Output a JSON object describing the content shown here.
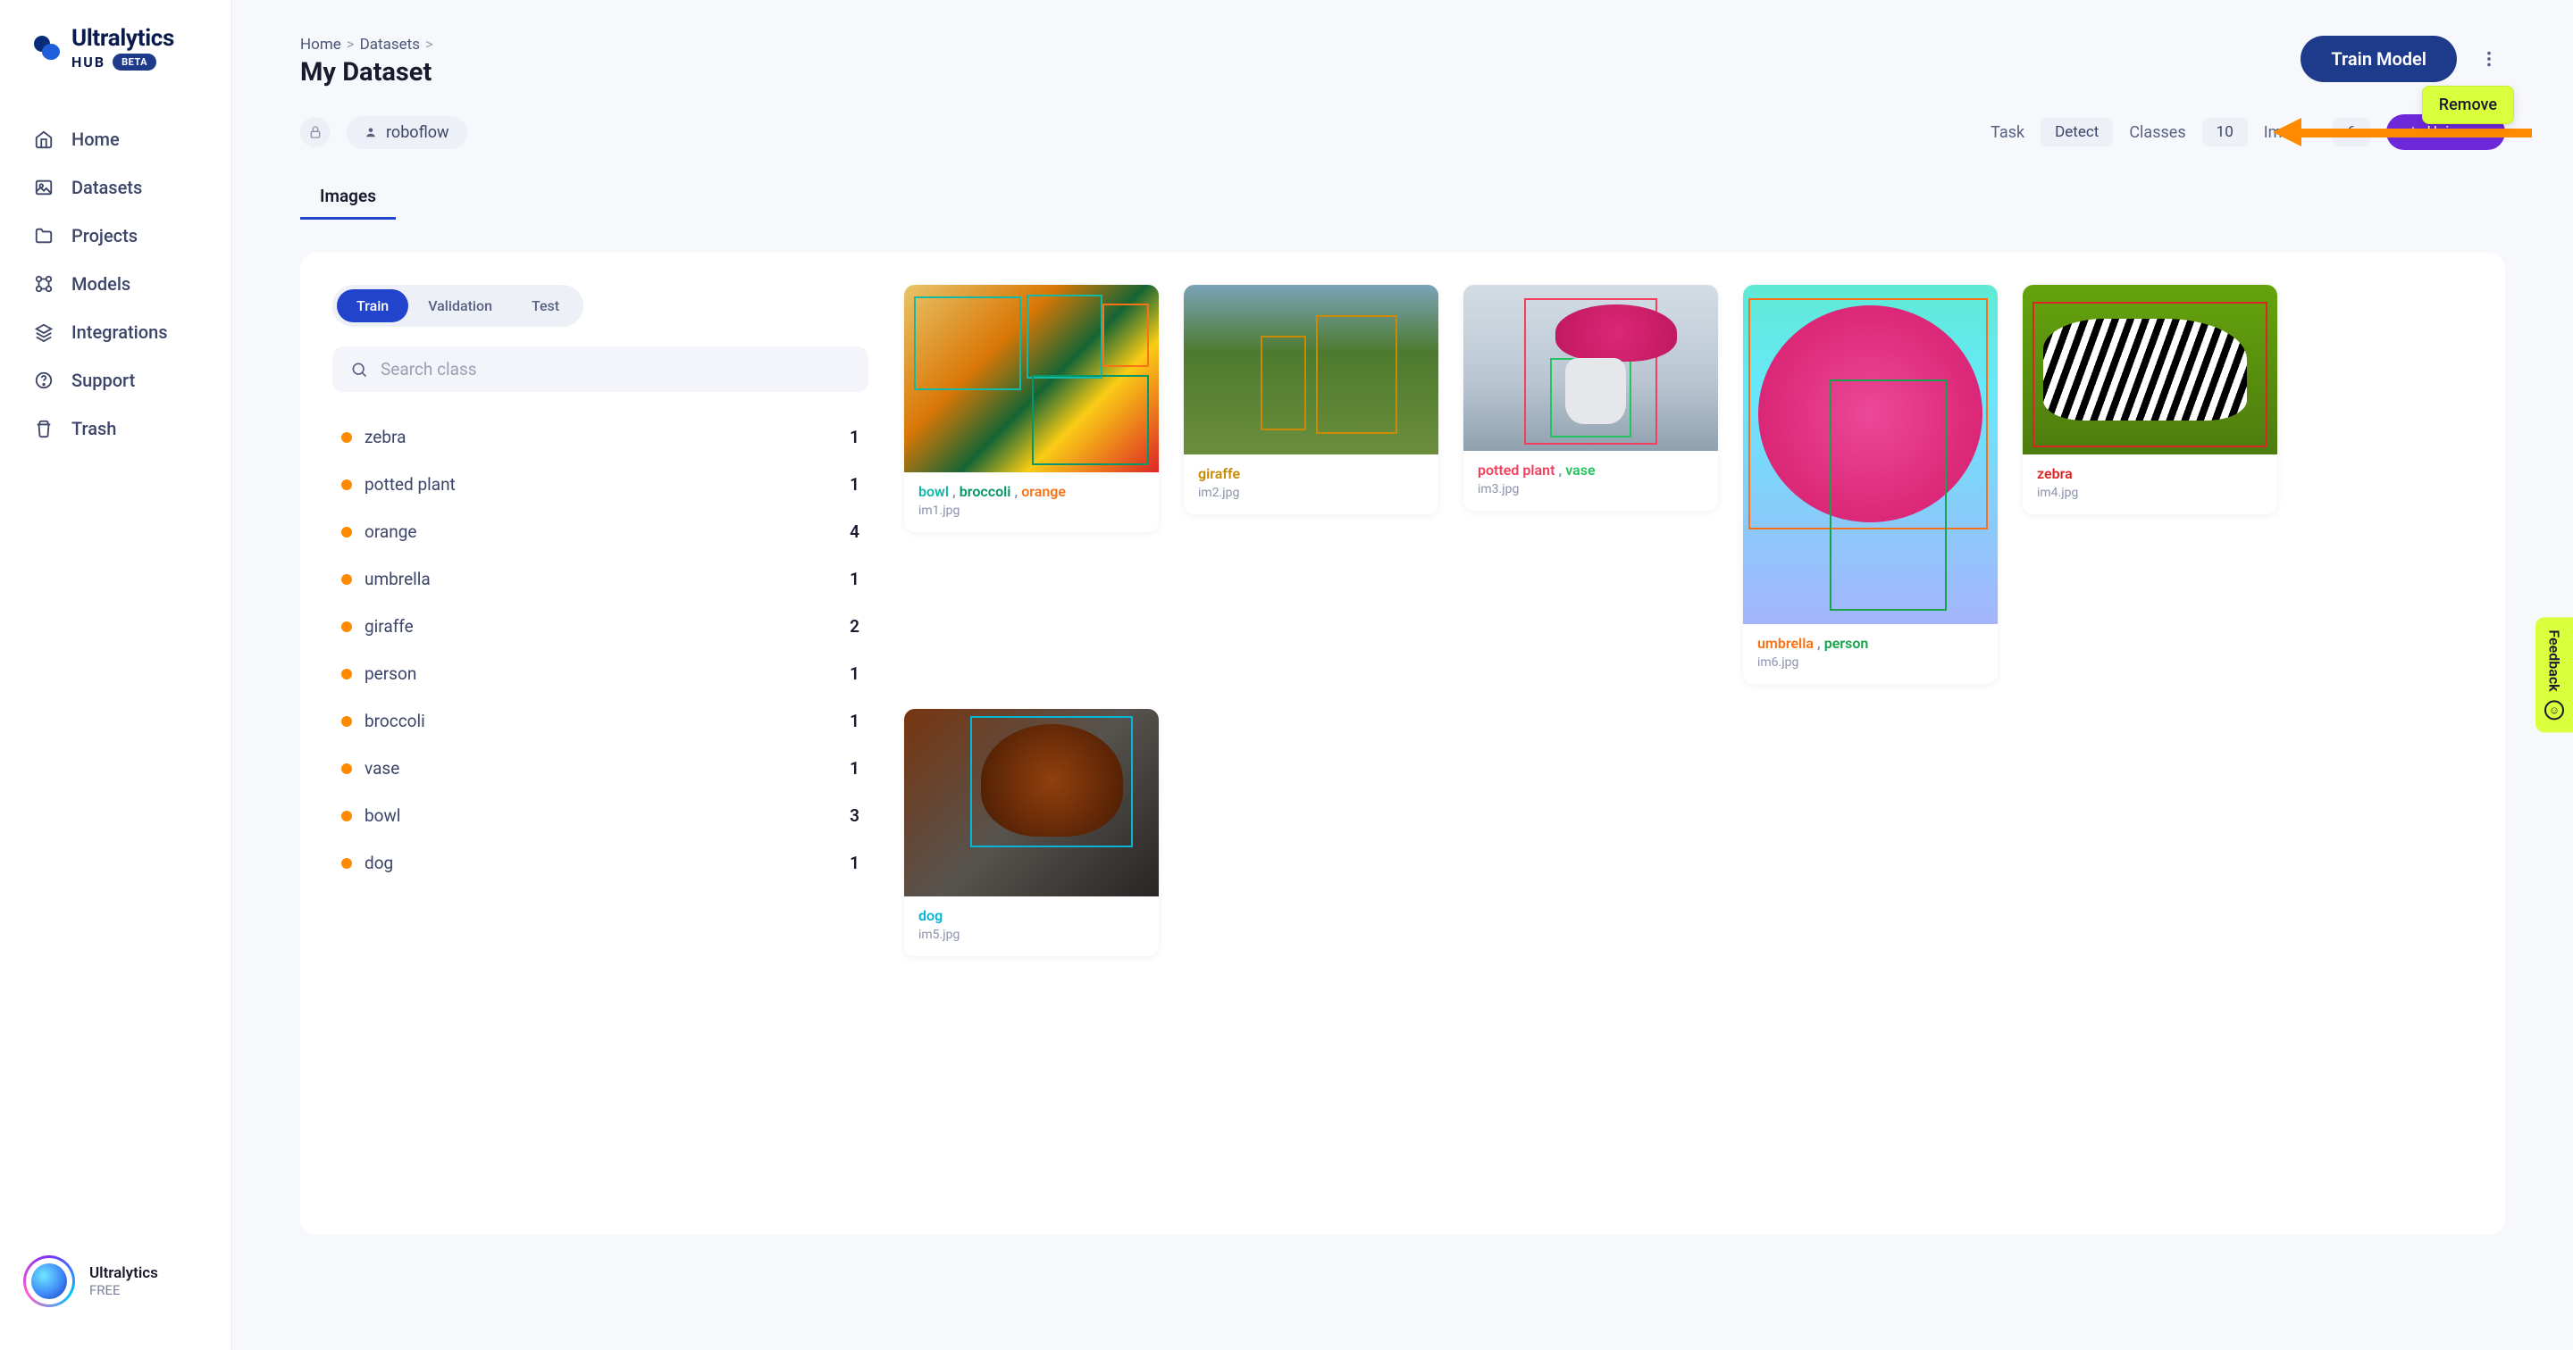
{
  "brand": {
    "name": "Ultralytics",
    "hub": "HUB",
    "beta": "BETA"
  },
  "sidebar": {
    "items": [
      {
        "label": "Home"
      },
      {
        "label": "Datasets"
      },
      {
        "label": "Projects"
      },
      {
        "label": "Models"
      },
      {
        "label": "Integrations"
      },
      {
        "label": "Support"
      },
      {
        "label": "Trash"
      }
    ]
  },
  "profile": {
    "name": "Ultralytics",
    "plan": "FREE"
  },
  "breadcrumbs": {
    "home": "Home",
    "datasets": "Datasets"
  },
  "page": {
    "title": "My Dataset"
  },
  "actions": {
    "train": "Train Model",
    "remove": "Remove"
  },
  "owner": "roboflow",
  "meta": {
    "task_label": "Task",
    "task_value": "Detect",
    "classes_label": "Classes",
    "classes_value": "10",
    "images_label": "Images",
    "images_value": "6",
    "universe": "Universe"
  },
  "tabs": {
    "images": "Images"
  },
  "splits": {
    "train": "Train",
    "validation": "Validation",
    "test": "Test"
  },
  "search": {
    "placeholder": "Search class"
  },
  "classes": [
    {
      "name": "zebra",
      "count": "1"
    },
    {
      "name": "potted plant",
      "count": "1"
    },
    {
      "name": "orange",
      "count": "4"
    },
    {
      "name": "umbrella",
      "count": "1"
    },
    {
      "name": "giraffe",
      "count": "2"
    },
    {
      "name": "person",
      "count": "1"
    },
    {
      "name": "broccoli",
      "count": "1"
    },
    {
      "name": "vase",
      "count": "1"
    },
    {
      "name": "bowl",
      "count": "3"
    },
    {
      "name": "dog",
      "count": "1"
    }
  ],
  "colors": {
    "bowl": "#14b8a6",
    "broccoli": "#059669",
    "orange": "#f97316",
    "giraffe": "#ca8a04",
    "potted_plant": "#f43f5e",
    "vase": "#22c55e",
    "zebra": "#dc2626",
    "dog": "#06b6d4",
    "umbrella": "#f97316",
    "person": "#16a34a"
  },
  "images": [
    {
      "file": "im1.jpg",
      "labels": [
        "bowl",
        "broccoli",
        "orange"
      ],
      "label_colors": [
        "#14b8a6",
        "#059669",
        "#f97316"
      ]
    },
    {
      "file": "im2.jpg",
      "labels": [
        "giraffe"
      ],
      "label_colors": [
        "#ca8a04"
      ]
    },
    {
      "file": "im3.jpg",
      "labels": [
        "potted plant",
        "vase"
      ],
      "label_colors": [
        "#f43f5e",
        "#22c55e"
      ]
    },
    {
      "file": "im4.jpg",
      "labels": [
        "zebra"
      ],
      "label_colors": [
        "#dc2626"
      ]
    },
    {
      "file": "im5.jpg",
      "labels": [
        "dog"
      ],
      "label_colors": [
        "#06b6d4"
      ]
    },
    {
      "file": "im6.jpg",
      "labels": [
        "umbrella",
        "person"
      ],
      "label_colors": [
        "#f97316",
        "#16a34a"
      ]
    }
  ],
  "feedback": {
    "label": "Feedback"
  }
}
